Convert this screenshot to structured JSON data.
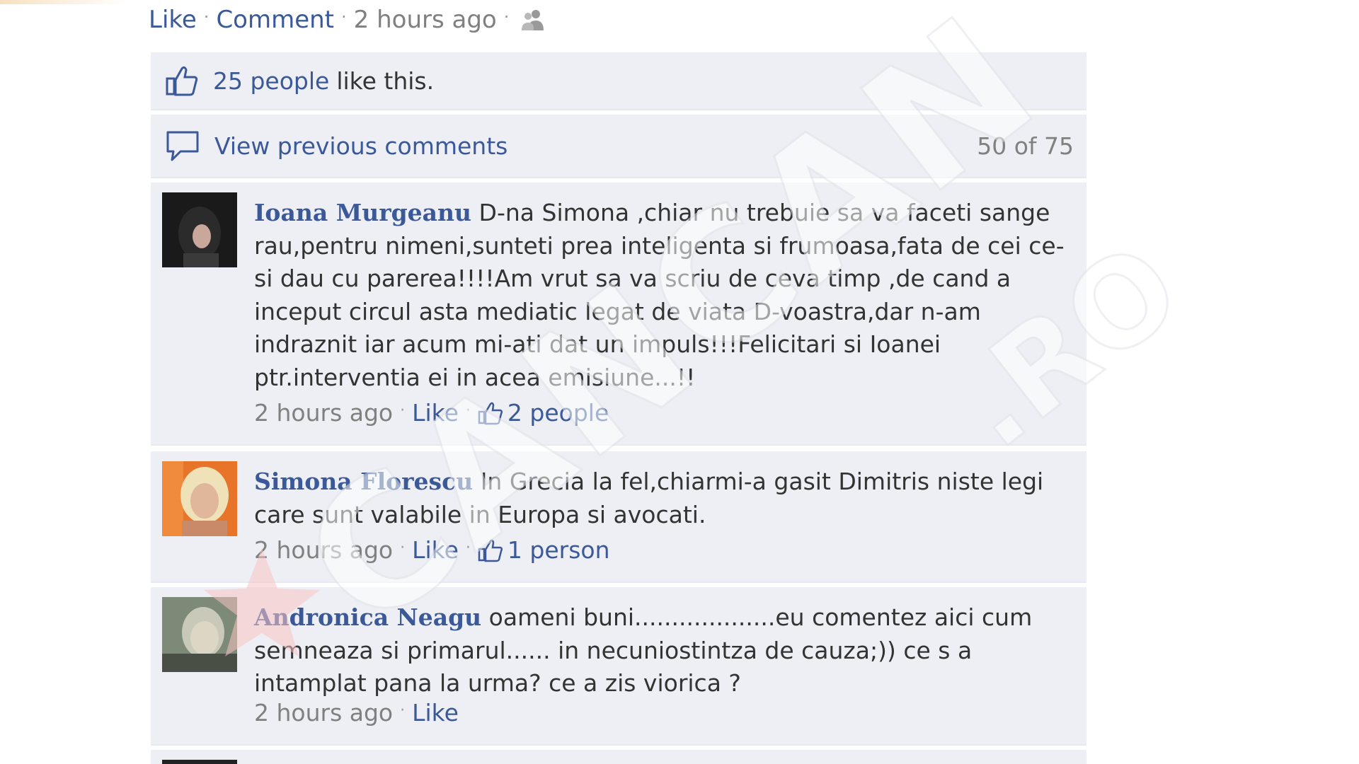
{
  "post_actions": {
    "like": "Like",
    "comment": "Comment",
    "time": "2 hours ago",
    "separator": "·"
  },
  "likes": {
    "count_link": "25 people",
    "suffix": "like this."
  },
  "previous": {
    "link": "View previous comments",
    "count": "50 of 75"
  },
  "comments": [
    {
      "author": "Ioana Murgeanu",
      "text": "D-na Simona ,chiar nu trebuie sa va faceti sange rau,pentru nimeni,sunteti prea inteligenta si frumoasa,fata de cei ce-si dau cu parerea!!!!Am vrut sa va scriu de ceva timp ,de cand a inceput circul asta mediatic legat de viata D-voastra,dar n-am indraznit iar acum mi-ati dat un impuls!!!Felicitari si Ioanei ptr.interventia ei in acea emisiune...!!",
      "time": "2 hours ago",
      "like": "Like",
      "likes": "2 people"
    },
    {
      "author": "Simona Florescu",
      "text": "In Grecia la fel,chiarmi-a gasit Dimitris niste legi care sunt valabile in Europa si avocati.",
      "time": "2 hours ago",
      "like": "Like",
      "likes": "1 person"
    },
    {
      "author": "Andronica Neagu",
      "text": "oameni buni...................eu comentez aici cum semneaza si primarul...... in necuniostintza de cauza;)) ce s a intamplat pana la urma? ce a zis viorica ?",
      "time": "2 hours ago",
      "like": "Like"
    }
  ],
  "watermark": "CANCAN.RO",
  "colors": {
    "link": "#3b5998",
    "panel": "#edeff4",
    "muted": "#808080"
  }
}
